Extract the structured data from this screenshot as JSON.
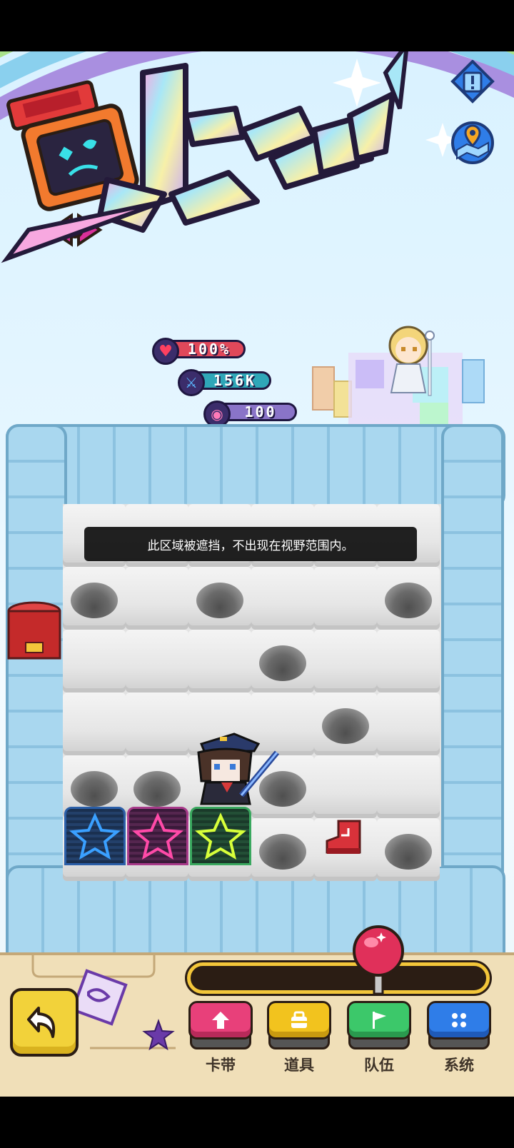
{
  "stats": {
    "hp": "100%",
    "attack": "156K",
    "gems": "100"
  },
  "notice": "此区域被遮挡，不出现在视野范围内。",
  "bottom_buttons": [
    {
      "label": "卡带",
      "icon": "up-arrow-icon",
      "color": "#e8407a"
    },
    {
      "label": "道具",
      "icon": "bag-icon",
      "color": "#f2c31e"
    },
    {
      "label": "队伍",
      "icon": "flag-icon",
      "color": "#3cc86a"
    },
    {
      "label": "系统",
      "icon": "grid-dots-icon",
      "color": "#2f7de8"
    }
  ],
  "side_buttons": [
    {
      "icon": "alert-icon"
    },
    {
      "icon": "map-pin-icon"
    }
  ],
  "back_icon": "back-arrow-icon",
  "colors": {
    "hp": "#e0485a",
    "attack": "#2fa7b8",
    "gems": "#8a74c8",
    "accent": "#f3c63a"
  }
}
